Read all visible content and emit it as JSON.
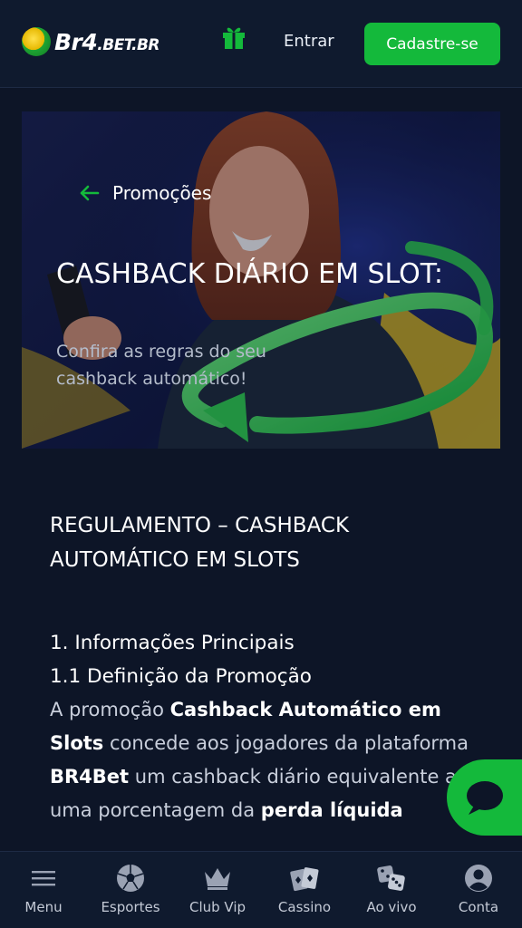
{
  "header": {
    "logo_text_main": "Br4",
    "logo_text_suffix": ".BET.BR",
    "login_label": "Entrar",
    "signup_label": "Cadastre-se",
    "accent_color": "#14b93b"
  },
  "hero": {
    "back_label": "Promoções",
    "title": "CASHBACK DIÁRIO EM SLOT:",
    "subtitle": "Confira as regras do seu cashback automático!"
  },
  "content": {
    "regulation_title": "REGULAMENTO – CASHBACK AUTOMÁTICO EM SLOTS",
    "section_heading": "1. Informações Principais",
    "sub_heading": "1.1 Definição da Promoção",
    "para_part1": "A promoção ",
    "para_bold1": "Cashback Automático em Slots",
    "para_part2": " concede aos jogadores da plataforma ",
    "para_bold2": "BR4Bet",
    "para_part3": " um cashback diário equivalente a uma porcentagem da ",
    "para_bold3": "perda líquida"
  },
  "bottom_nav": {
    "items": [
      {
        "label": "Menu",
        "icon": "hamburger-menu-icon"
      },
      {
        "label": "Esportes",
        "icon": "soccer-ball-icon"
      },
      {
        "label": "Club Vip",
        "icon": "crown-icon"
      },
      {
        "label": "Cassino",
        "icon": "playing-cards-icon"
      },
      {
        "label": "Ao vivo",
        "icon": "dice-icon"
      },
      {
        "label": "Conta",
        "icon": "user-avatar-icon"
      }
    ]
  }
}
